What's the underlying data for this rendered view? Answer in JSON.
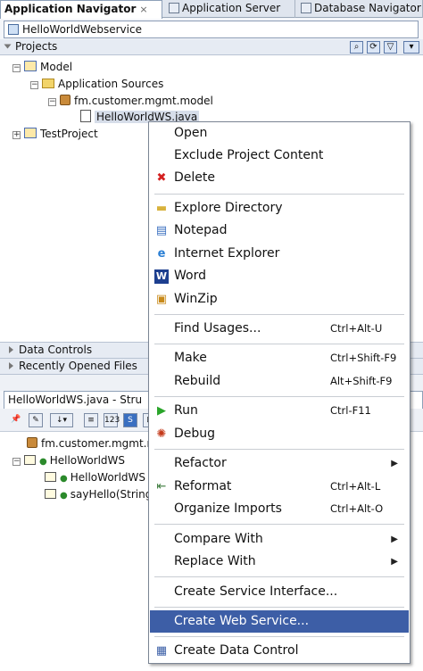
{
  "tabs": [
    {
      "label": "Application Navigator",
      "active": true
    },
    {
      "label": "Application Server",
      "active": false
    },
    {
      "label": "Database Navigator",
      "active": false
    }
  ],
  "tab_close": "×",
  "app_combo": {
    "value": "HelloWorldWebservice"
  },
  "projects_header": "Projects",
  "projects_tree": {
    "model": "Model",
    "app_sources": "Application Sources",
    "package": "fm.customer.mgmt.model",
    "java_file": "HelloWorldWS.java",
    "test_project": "TestProject"
  },
  "accordions": {
    "data_controls": "Data Controls",
    "recently_opened": "Recently Opened Files"
  },
  "structure": {
    "tab_label": "HelloWorldWS.java - Stru",
    "tree": {
      "package": "fm.customer.mgmt.m",
      "class": "HelloWorldWS",
      "constructor": "HelloWorldWS",
      "method": "sayHello(String"
    }
  },
  "context_menu": {
    "open": "Open",
    "exclude": "Exclude Project Content",
    "delete": "Delete",
    "explore": "Explore Directory",
    "notepad": "Notepad",
    "ie": "Internet Explorer",
    "word": "Word",
    "winzip": "WinZip",
    "find_usages": "Find Usages...",
    "find_usages_key": "Ctrl+Alt-U",
    "make": "Make",
    "make_key": "Ctrl+Shift-F9",
    "rebuild": "Rebuild",
    "rebuild_key": "Alt+Shift-F9",
    "run": "Run",
    "run_key": "Ctrl-F11",
    "debug": "Debug",
    "refactor": "Refactor",
    "reformat": "Reformat",
    "reformat_key": "Ctrl+Alt-L",
    "organize": "Organize Imports",
    "organize_key": "Ctrl+Alt-O",
    "compare": "Compare With",
    "replace": "Replace With",
    "create_service": "Create Service Interface...",
    "create_web_service": "Create Web Service...",
    "create_data_control": "Create Data Control"
  }
}
